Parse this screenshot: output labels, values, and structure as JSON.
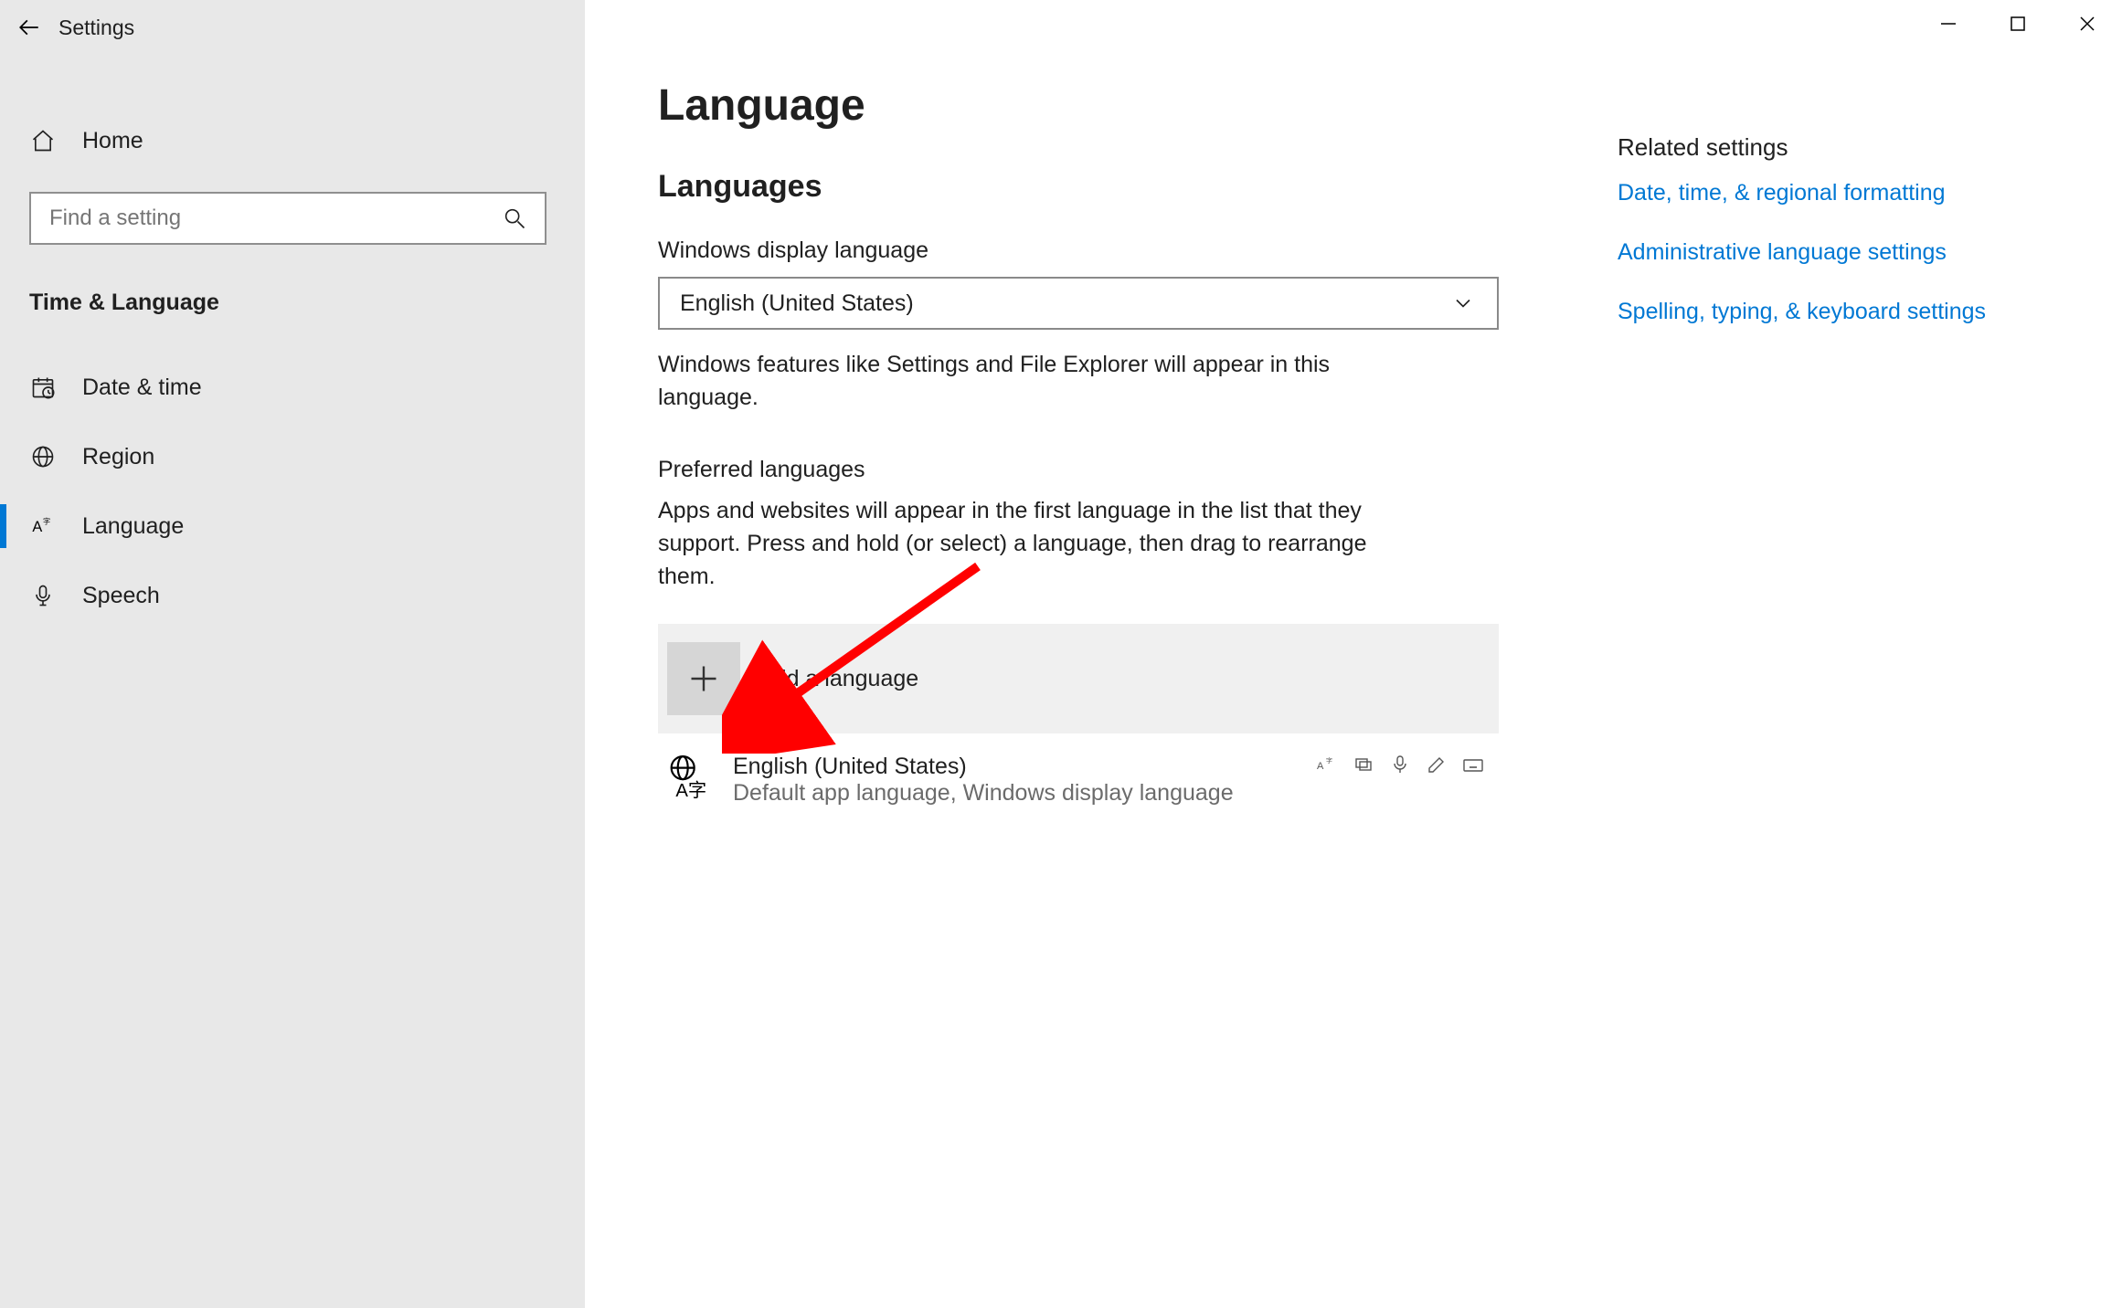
{
  "app_title": "Settings",
  "search": {
    "placeholder": "Find a setting"
  },
  "nav": {
    "home_label": "Home",
    "category": "Time & Language",
    "items": [
      {
        "label": "Date & time"
      },
      {
        "label": "Region"
      },
      {
        "label": "Language"
      },
      {
        "label": "Speech"
      }
    ]
  },
  "page": {
    "title": "Language",
    "section1_title": "Languages",
    "display_label": "Windows display language",
    "display_value": "English (United States)",
    "display_desc": "Windows features like Settings and File Explorer will appear in this language.",
    "preferred_label": "Preferred languages",
    "preferred_desc": "Apps and websites will appear in the first language in the list that they support. Press and hold (or select) a language, then drag to rearrange them.",
    "add_label": "Add a language",
    "lang0_name": "English (United States)",
    "lang0_sub": "Default app language, Windows display language"
  },
  "rail": {
    "title": "Related settings",
    "link0": "Date, time, & regional formatting",
    "link1": "Administrative language settings",
    "link2": "Spelling, typing, & keyboard settings"
  }
}
